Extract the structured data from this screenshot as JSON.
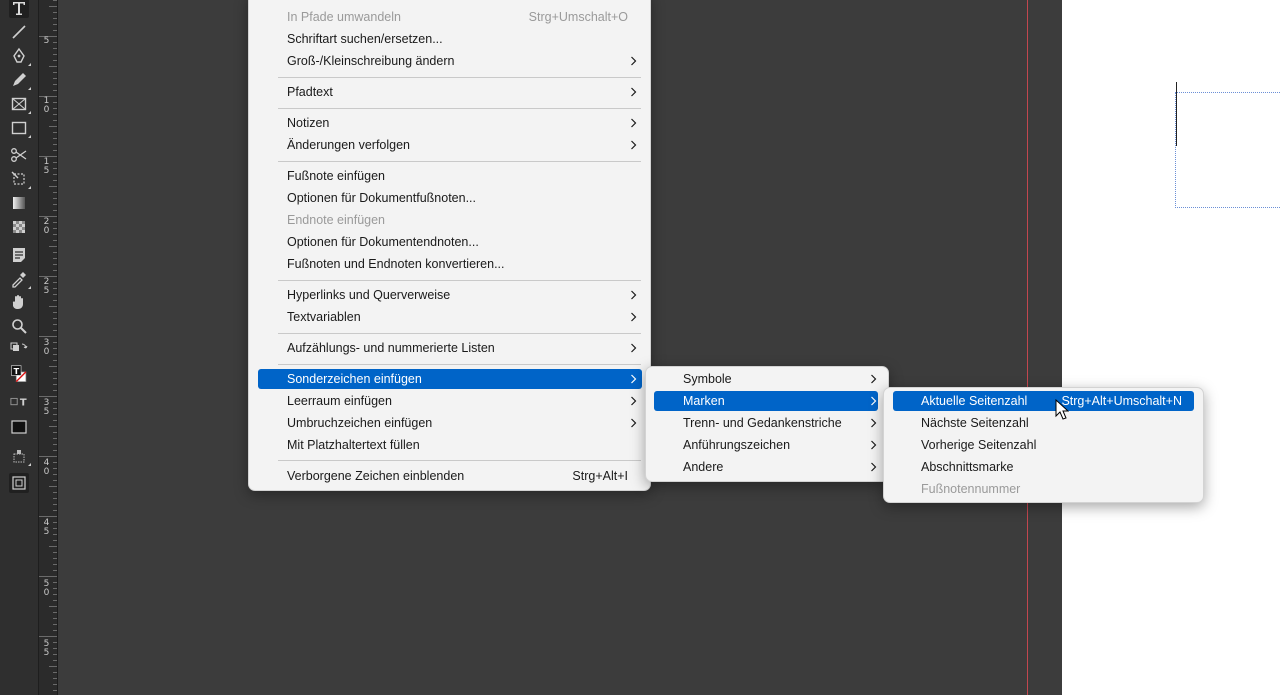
{
  "colors": {
    "highlight": "#0064c8",
    "menu_bg": "#f3f3f3",
    "pasteboard": "#3c3c3c",
    "bleed": "#c2474f"
  },
  "ruler_labels": [
    {
      "a": "5",
      "b": ""
    },
    {
      "a": "1",
      "b": "0"
    },
    {
      "a": "1",
      "b": "5"
    },
    {
      "a": "2",
      "b": "0"
    },
    {
      "a": "2",
      "b": "5"
    },
    {
      "a": "3",
      "b": "0"
    },
    {
      "a": "3",
      "b": "5"
    },
    {
      "a": "4",
      "b": "0"
    },
    {
      "a": "4",
      "b": "5"
    },
    {
      "a": "5",
      "b": "0"
    },
    {
      "a": "5",
      "b": "5"
    },
    {
      "a": "6",
      "b": "0"
    }
  ],
  "tools": [
    "type-tool-icon",
    "line-tool-icon",
    "pen-tool-icon",
    "pencil-tool-icon",
    "rectangle-frame-tool-icon",
    "rectangle-tool-icon",
    "scissors-tool-icon",
    "free-transform-tool-icon",
    "gradient-swatch-tool-icon",
    "gradient-feather-tool-icon",
    "note-tool-icon",
    "eyedropper-tool-icon",
    "hand-tool-icon",
    "zoom-tool-icon"
  ],
  "menu": {
    "items": [
      {
        "label": "In Pfade umwandeln",
        "shortcut": "Strg+Umschalt+O",
        "disabled": true
      },
      {
        "label": "Schriftart suchen/ersetzen..."
      },
      {
        "label": "Groß-/Kleinschreibung ändern",
        "submenu": true
      },
      {
        "label": "Pfadtext",
        "submenu": true
      },
      {
        "label": "Notizen",
        "submenu": true
      },
      {
        "label": "Änderungen verfolgen",
        "submenu": true
      },
      {
        "label": "Fußnote einfügen"
      },
      {
        "label": "Optionen für Dokumentfußnoten..."
      },
      {
        "label": "Endnote einfügen",
        "disabled": true
      },
      {
        "label": "Optionen für Dokumentendnoten..."
      },
      {
        "label": "Fußnoten und Endnoten konvertieren..."
      },
      {
        "label": "Hyperlinks und Querverweise",
        "submenu": true
      },
      {
        "label": "Textvariablen",
        "submenu": true
      },
      {
        "label": "Aufzählungs- und nummerierte Listen",
        "submenu": true
      },
      {
        "label": "Sonderzeichen einfügen",
        "submenu": true,
        "highlighted": true
      },
      {
        "label": "Leerraum einfügen",
        "submenu": true
      },
      {
        "label": "Umbruchzeichen einfügen",
        "submenu": true
      },
      {
        "label": "Mit Platzhaltertext füllen"
      },
      {
        "label": "Verborgene Zeichen einblenden",
        "shortcut": "Strg+Alt+I"
      }
    ]
  },
  "submenu": {
    "items": [
      {
        "label": "Symbole",
        "submenu": true
      },
      {
        "label": "Marken",
        "submenu": true,
        "highlighted": true
      },
      {
        "label": "Trenn- und Gedankenstriche",
        "submenu": true
      },
      {
        "label": "Anführungszeichen",
        "submenu": true
      },
      {
        "label": "Andere",
        "submenu": true
      }
    ]
  },
  "submenu2": {
    "items": [
      {
        "label": "Aktuelle Seitenzahl",
        "shortcut": "Strg+Alt+Umschalt+N",
        "highlighted": true
      },
      {
        "label": "Nächste Seitenzahl"
      },
      {
        "label": "Vorherige Seitenzahl"
      },
      {
        "label": "Abschnittsmarke"
      },
      {
        "label": "Fußnotennummer",
        "disabled": true
      }
    ]
  }
}
